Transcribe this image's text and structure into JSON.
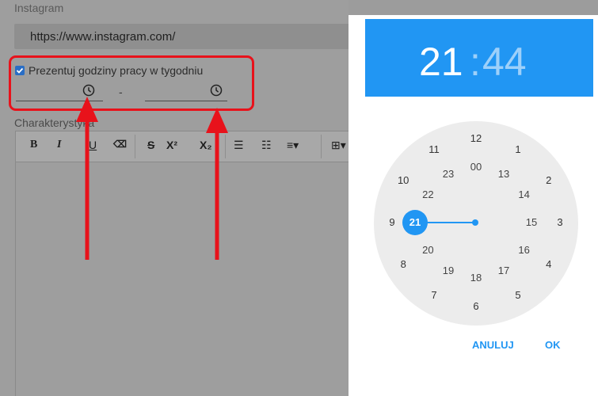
{
  "form": {
    "instagram_label": "Instagram",
    "instagram_url": "https://www.instagram.com/",
    "working_hours_checkbox_label": "Prezentuj godziny pracy w tygodniu",
    "time_separator": "-",
    "description_label": "Charakterystyka",
    "toolbar": {
      "bold": "B",
      "italic": "I",
      "underline": "U",
      "eraser": "⌫",
      "strike": "S",
      "superscript": "X²",
      "subscript": "X₂",
      "bullet_list": "☰",
      "ordered_list": "☷",
      "align": "≡▾",
      "table": "⊞▾"
    }
  },
  "time_picker": {
    "hours": "21",
    "colon": ":",
    "minutes": "44",
    "outer_numbers": [
      "12",
      "1",
      "2",
      "3",
      "4",
      "5",
      "6",
      "7",
      "8",
      "9",
      "10",
      "11"
    ],
    "inner_numbers": [
      "00",
      "13",
      "14",
      "15",
      "16",
      "17",
      "18",
      "19",
      "20",
      "21",
      "22",
      "23"
    ],
    "selected_hour": "21",
    "cancel_label": "ANULUJ",
    "ok_label": "OK"
  },
  "colors": {
    "accent": "#2196f3",
    "highlight": "#e8121b"
  }
}
